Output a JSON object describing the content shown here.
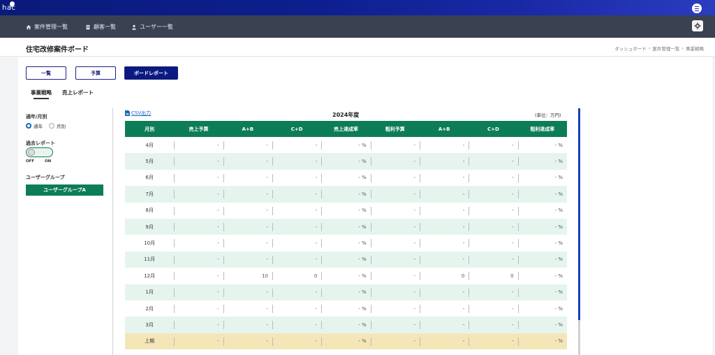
{
  "app": {
    "logo_text": "hac"
  },
  "nav": {
    "items": [
      {
        "label": "案件管理一覧",
        "icon": "home-icon"
      },
      {
        "label": "顧客一覧",
        "icon": "document-icon"
      },
      {
        "label": "ユーザー一覧",
        "icon": "person-icon"
      }
    ]
  },
  "page": {
    "title": "住宅改修案件ボード",
    "breadcrumb": [
      "ダッシュボード",
      "案件管理一覧",
      "事業戦略"
    ]
  },
  "view_buttons": [
    "一覧",
    "予算",
    "ボードレポート"
  ],
  "subtabs": [
    "事業戦略",
    "売上レポート"
  ],
  "filters": {
    "period_label": "通年/月別",
    "period_options": [
      "通年",
      "月別"
    ],
    "period_selected": "通年",
    "past_report_label": "過去レポート",
    "toggle_off": "OFF",
    "toggle_on": "ON",
    "past_report_on": false,
    "user_group_label": "ユーザーグループ",
    "user_group_value": "ユーザーグループA"
  },
  "table": {
    "csv_label": "CSV出力",
    "year_title": "2024年度",
    "unit_label": "(単位：万円)",
    "headers": [
      "月別",
      "売上予算",
      "A+B",
      "C+D",
      "売上達成率",
      "粗利予算",
      "A+B",
      "C+D",
      "粗利達成率"
    ],
    "rows": [
      [
        "4月",
        "-",
        "-",
        "-",
        "- %",
        "-",
        "-",
        "-",
        "- %"
      ],
      [
        "5月",
        "-",
        "-",
        "-",
        "- %",
        "-",
        "-",
        "-",
        "- %"
      ],
      [
        "6月",
        "-",
        "-",
        "-",
        "- %",
        "-",
        "-",
        "-",
        "- %"
      ],
      [
        "7月",
        "-",
        "-",
        "-",
        "- %",
        "-",
        "-",
        "-",
        "- %"
      ],
      [
        "8月",
        "-",
        "-",
        "-",
        "- %",
        "-",
        "-",
        "-",
        "- %"
      ],
      [
        "9月",
        "-",
        "-",
        "-",
        "- %",
        "-",
        "-",
        "-",
        "- %"
      ],
      [
        "10月",
        "-",
        "-",
        "-",
        "- %",
        "-",
        "-",
        "-",
        "- %"
      ],
      [
        "11月",
        "-",
        "-",
        "-",
        "- %",
        "-",
        "-",
        "-",
        "- %"
      ],
      [
        "12月",
        "-",
        "10",
        "0",
        "- %",
        "-",
        "0",
        "0",
        "- %"
      ],
      [
        "1月",
        "-",
        "-",
        "-",
        "- %",
        "-",
        "-",
        "-",
        "- %"
      ],
      [
        "2月",
        "-",
        "-",
        "-",
        "- %",
        "-",
        "-",
        "-",
        "- %"
      ],
      [
        "3月",
        "-",
        "-",
        "-",
        "- %",
        "-",
        "-",
        "-",
        "- %"
      ],
      [
        "上期",
        "-",
        "-",
        "-",
        "- %",
        "-",
        "-",
        "-",
        "- %"
      ]
    ]
  },
  "colors": {
    "brand": "#0b1a80",
    "table_header": "#0d7c58",
    "row_alt": "#e6f4ee",
    "total_row": "#f5e6b8"
  }
}
